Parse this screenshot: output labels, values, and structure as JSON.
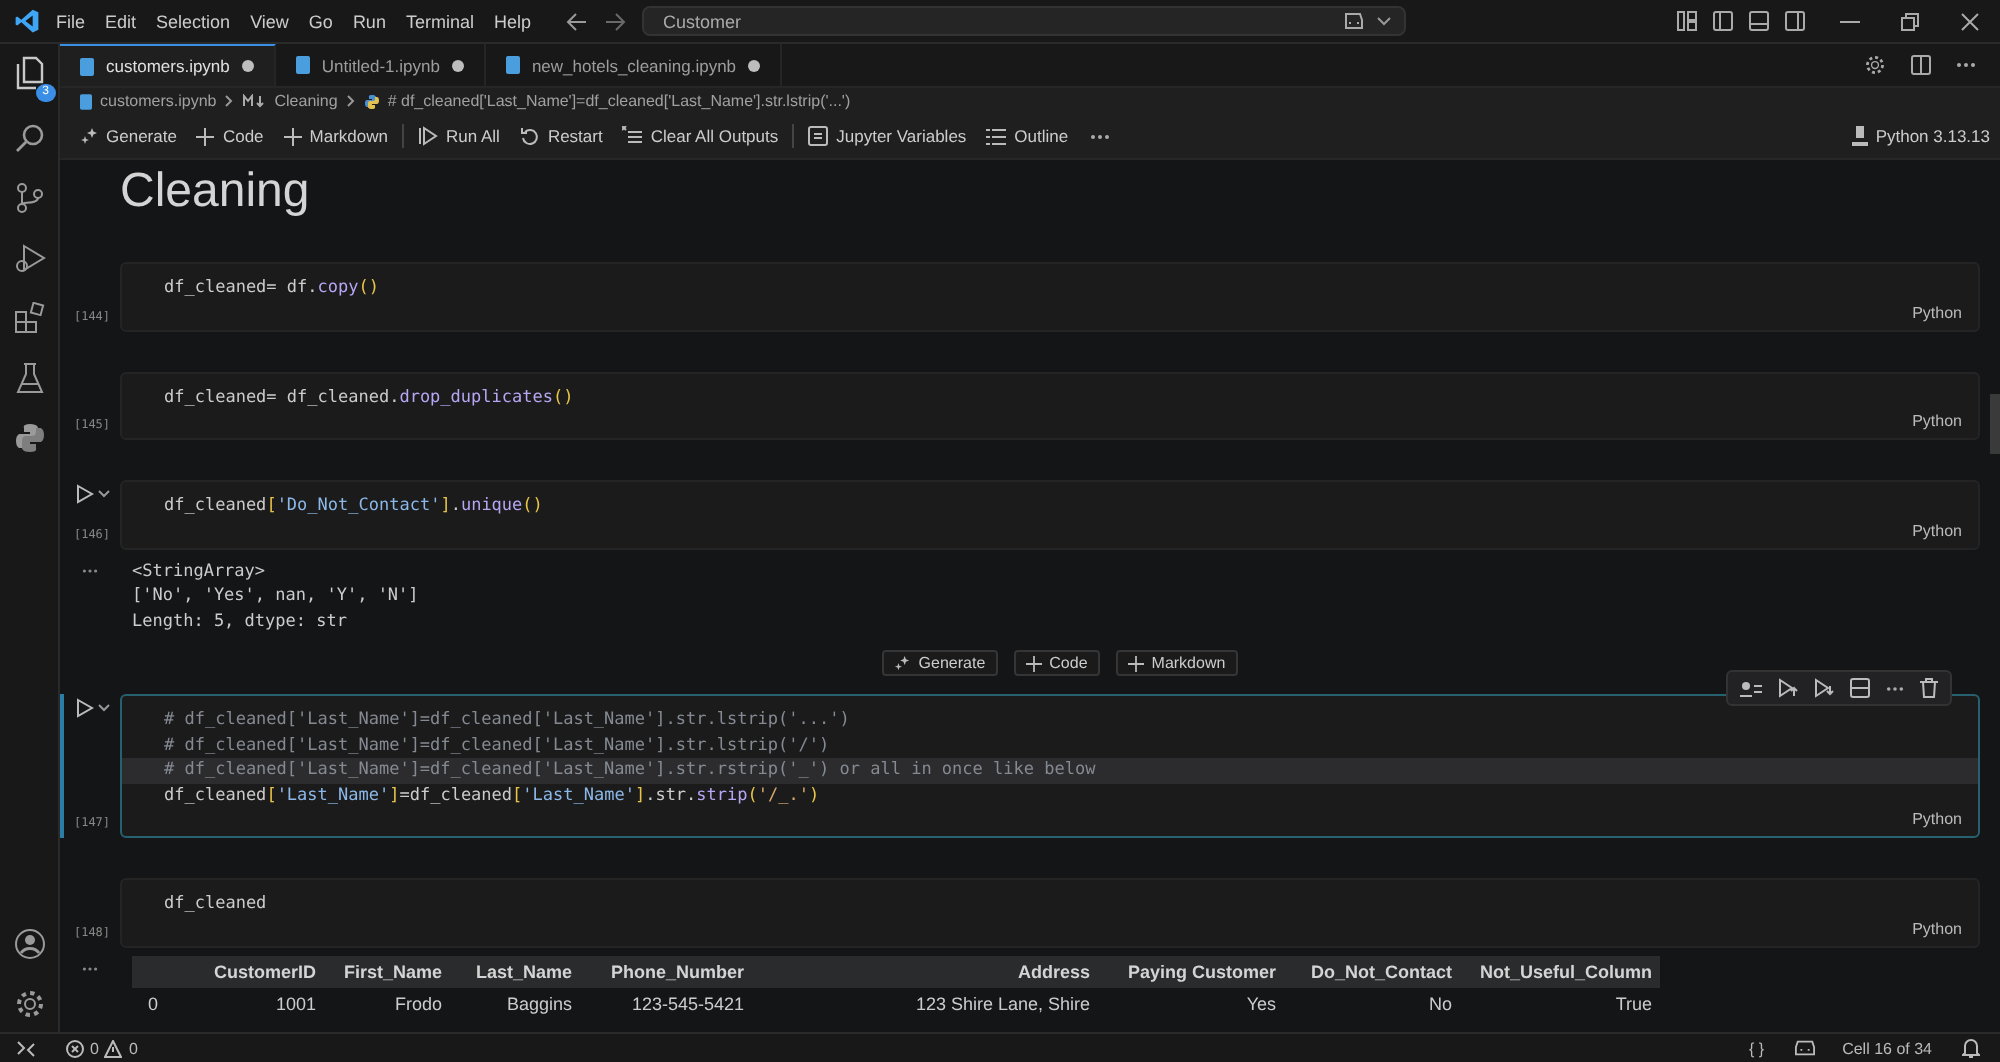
{
  "menu": [
    "File",
    "Edit",
    "Selection",
    "View",
    "Go",
    "Run",
    "Terminal",
    "Help"
  ],
  "command_center": {
    "value": "Customer"
  },
  "activity_badge": "3",
  "tabs": [
    {
      "label": "customers.ipynb",
      "selected": true
    },
    {
      "label": "Untitled-1.ipynb",
      "selected": false
    },
    {
      "label": "new_hotels_cleaning.ipynb",
      "selected": false
    }
  ],
  "breadcrumb": [
    "customers.ipynb",
    "Cleaning",
    "# df_cleaned['Last_Name']=df_cleaned['Last_Name'].str.lstrip('...')"
  ],
  "toolbar": {
    "groups": [
      [
        {
          "label": "Generate",
          "kind": "generate"
        },
        {
          "label": "Code",
          "kind": "add"
        },
        {
          "label": "Markdown",
          "kind": "add"
        }
      ],
      [
        {
          "label": "Run All",
          "kind": "run-all"
        },
        {
          "label": "Restart",
          "kind": "restart"
        },
        {
          "label": "Clear All Outputs",
          "kind": "clear"
        }
      ],
      [
        {
          "label": "Jupyter Variables",
          "kind": "variables"
        },
        {
          "label": "Outline",
          "kind": "outline"
        }
      ]
    ],
    "kernel": "Python 3.13.13"
  },
  "notebook": [
    {
      "kind": "markdown",
      "heading": "Cleaning"
    },
    {
      "kind": "code",
      "count": "[144]",
      "language": "Python",
      "selected": false,
      "run_button": false,
      "lines": [
        {
          "current": false,
          "tokens": [
            {
              "kind": "plain",
              "text": "df_cleaned= df."
            },
            {
              "kind": "method",
              "text": "copy"
            },
            {
              "kind": "bracket",
              "text": "()"
            }
          ]
        }
      ]
    },
    {
      "kind": "code",
      "count": "[145]",
      "language": "Python",
      "selected": false,
      "run_button": false,
      "lines": [
        {
          "current": false,
          "tokens": [
            {
              "kind": "plain",
              "text": "df_cleaned= df_cleaned."
            },
            {
              "kind": "method",
              "text": "drop_duplicates"
            },
            {
              "kind": "bracket",
              "text": "()"
            }
          ]
        }
      ]
    },
    {
      "kind": "code",
      "count": "[146]",
      "language": "Python",
      "selected": false,
      "run_button": true,
      "lines": [
        {
          "current": false,
          "tokens": [
            {
              "kind": "plain",
              "text": "df_cleaned"
            },
            {
              "kind": "bracket",
              "text": "["
            },
            {
              "kind": "string",
              "text": "'Do_Not_Contact'"
            },
            {
              "kind": "bracket",
              "text": "]"
            },
            {
              "kind": "plain",
              "text": "."
            },
            {
              "kind": "method",
              "text": "unique"
            },
            {
              "kind": "bracket",
              "text": "()"
            }
          ]
        }
      ],
      "output": {
        "kind": "text",
        "lines": [
          "<StringArray>",
          "['No', 'Yes', nan, 'Y', 'N']",
          "Length: 5, dtype: str"
        ]
      }
    },
    {
      "kind": "insert",
      "buttons": [
        {
          "label": "Generate",
          "kind": "generate"
        },
        {
          "label": "Code",
          "kind": "add"
        },
        {
          "label": "Markdown",
          "kind": "add"
        }
      ]
    },
    {
      "kind": "code",
      "count": "[147]",
      "language": "Python",
      "selected": true,
      "run_button": true,
      "lines": [
        {
          "current": false,
          "tokens": [
            {
              "kind": "comment",
              "text": "# df_cleaned['Last_Name']=df_cleaned['Last_Name'].str.lstrip('...')"
            }
          ]
        },
        {
          "current": false,
          "tokens": [
            {
              "kind": "comment",
              "text": "# df_cleaned['Last_Name']=df_cleaned['Last_Name'].str.lstrip('/')"
            }
          ]
        },
        {
          "current": true,
          "tokens": [
            {
              "kind": "comment",
              "text": "# df_cleaned['Last_Name']=df_cleaned['Last_Name'].str.rstrip('_') or all in once like below"
            }
          ]
        },
        {
          "current": false,
          "tokens": [
            {
              "kind": "plain",
              "text": "df_cleaned"
            },
            {
              "kind": "bracket",
              "text": "["
            },
            {
              "kind": "string",
              "text": "'Last_Name'"
            },
            {
              "kind": "bracket",
              "text": "]"
            },
            {
              "kind": "plain",
              "text": "=df_cleaned"
            },
            {
              "kind": "bracket",
              "text": "["
            },
            {
              "kind": "string",
              "text": "'Last_Name'"
            },
            {
              "kind": "bracket",
              "text": "]"
            },
            {
              "kind": "plain",
              "text": ".str."
            },
            {
              "kind": "method",
              "text": "strip"
            },
            {
              "kind": "bracket",
              "text": "("
            },
            {
              "kind": "literal",
              "text": "'/_.'"
            },
            {
              "kind": "bracket",
              "text": ")"
            }
          ]
        }
      ]
    },
    {
      "kind": "code",
      "count": "[148]",
      "language": "Python",
      "selected": false,
      "run_button": false,
      "lines": [
        {
          "current": false,
          "tokens": [
            {
              "kind": "plain",
              "text": "df_cleaned"
            }
          ]
        }
      ],
      "output": {
        "kind": "table",
        "columns": [
          "CustomerID",
          "First_Name",
          "Last_Name",
          "Phone_Number",
          "Address",
          "Paying Customer",
          "Do_Not_Contact",
          "Not_Useful_Column"
        ],
        "rows": [
          {
            "index": "0",
            "cells": [
              "1001",
              "Frodo",
              "Baggins",
              "123-545-5421",
              "123 Shire Lane, Shire",
              "Yes",
              "No",
              "True"
            ]
          }
        ]
      }
    }
  ],
  "status_bar": {
    "errors": "0",
    "warnings": "0",
    "braces": "{ }",
    "cell_position": "Cell 16 of 34"
  }
}
